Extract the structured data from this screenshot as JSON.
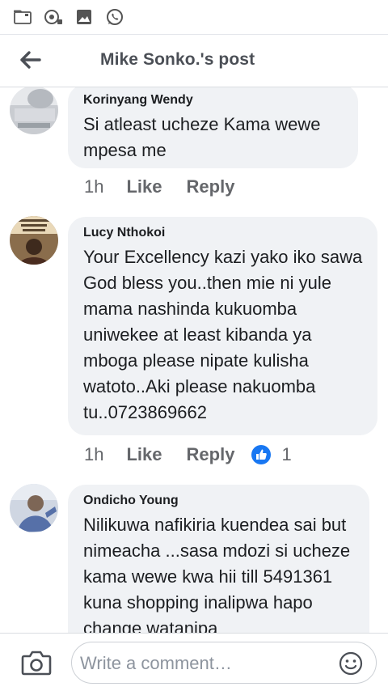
{
  "status_bar": {
    "icons": [
      "folder-icon",
      "podcast-icon",
      "gallery-icon",
      "whatsapp-icon"
    ]
  },
  "header": {
    "title": "Mike Sonko.'s post",
    "back_icon": "arrow-left-icon"
  },
  "comments": [
    {
      "author": "Korinyang Wendy",
      "text": "Si atleast ucheze Kama wewe mpesa me",
      "time": "1h",
      "like_label": "Like",
      "reply_label": "Reply"
    },
    {
      "author": "Lucy Nthokoi",
      "text": "Your Excellency kazi yako iko sawa God bless you..then mie ni yule mama nashinda kukuomba uniwekee at least kibanda ya mboga please nipate kulisha watoto..Aki please nakuomba tu..0723869662",
      "time": "1h",
      "like_label": "Like",
      "reply_label": "Reply",
      "reaction_count": "1"
    },
    {
      "author": "Ondicho Young",
      "text": "Nilikuwa nafikiria kuendea sai but nimeacha ...sasa mdozi si ucheze kama wewe kwa hii till 5491361 kuna shopping inalipwa hapo change watanipa"
    }
  ],
  "composer": {
    "placeholder": "Write a comment…"
  },
  "colors": {
    "bubble_bg": "#f0f2f5",
    "meta_text": "#65676b",
    "like_blue": "#1877f2",
    "whatsapp_green": "#25d366"
  }
}
